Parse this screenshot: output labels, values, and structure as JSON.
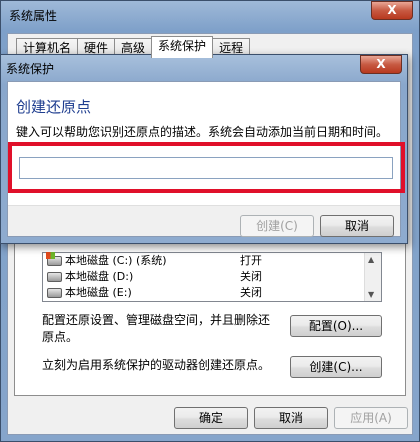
{
  "system_properties": {
    "title": "系统属性",
    "close_label": "X",
    "tabs": [
      {
        "label": "计算机名"
      },
      {
        "label": "硬件"
      },
      {
        "label": "高级"
      },
      {
        "label": "系统保护"
      },
      {
        "label": "远程"
      }
    ],
    "drives": [
      {
        "name": "本地磁盘 (C:) (系统)",
        "status": "打开"
      },
      {
        "name": "本地磁盘 (D:)",
        "status": "关闭"
      },
      {
        "name": "本地磁盘 (E:)",
        "status": "关闭"
      }
    ],
    "configure_desc_line1": "配置还原设置、管理磁盘空间，并且删除还",
    "configure_desc_line2": "原点。",
    "configure_button": "配置(O)...",
    "create_desc": "立刻为启用系统保护的驱动器创建还原点。",
    "create_button": "创建(C)...",
    "ok_button": "确定",
    "cancel_button": "取消",
    "apply_button": "应用(A)"
  },
  "create_dialog": {
    "title": "系统保护",
    "close_label": "X",
    "heading": "创建还原点",
    "instruction": "键入可以帮助您识别还原点的描述。系统会自动添加当前日期和时间。",
    "input_value": "",
    "create_button": "创建(C)",
    "cancel_button": "取消",
    "highlight_color": "#e0102a"
  }
}
